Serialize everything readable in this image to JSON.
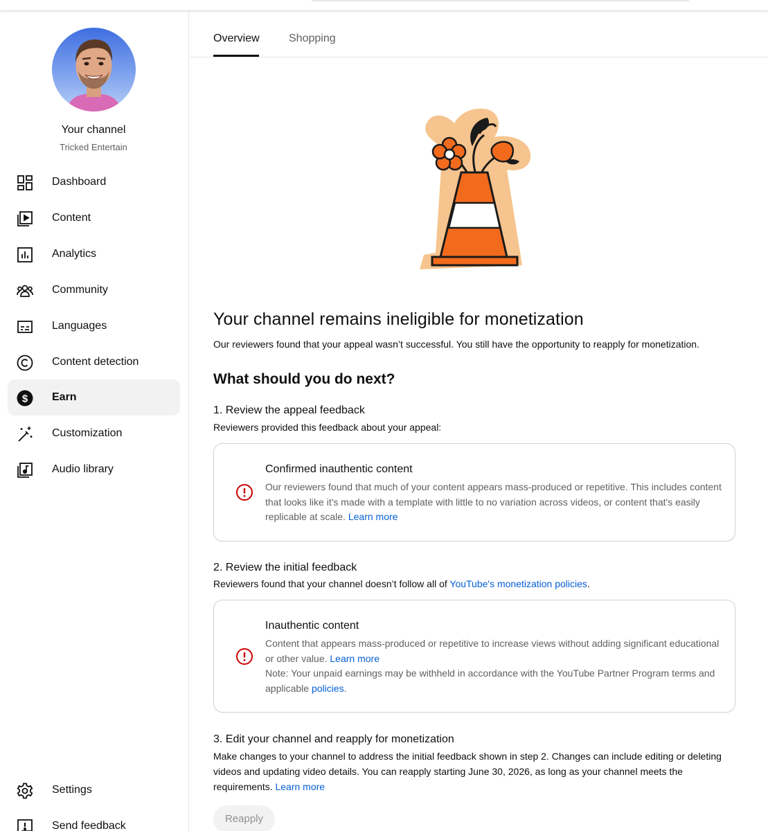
{
  "sidebar": {
    "channel_title": "Your channel",
    "channel_name": "Tricked Entertain",
    "items": [
      {
        "label": "Dashboard",
        "icon": "dashboard-icon"
      },
      {
        "label": "Content",
        "icon": "content-icon"
      },
      {
        "label": "Analytics",
        "icon": "analytics-icon"
      },
      {
        "label": "Community",
        "icon": "community-icon"
      },
      {
        "label": "Languages",
        "icon": "languages-icon"
      },
      {
        "label": "Content detection",
        "icon": "copyright-icon"
      },
      {
        "label": "Earn",
        "icon": "dollar-icon",
        "active": true
      },
      {
        "label": "Customization",
        "icon": "magic-wand-icon"
      },
      {
        "label": "Audio library",
        "icon": "audio-library-icon"
      }
    ],
    "bottom_items": [
      {
        "label": "Settings",
        "icon": "gear-icon"
      },
      {
        "label": "Send feedback",
        "icon": "feedback-icon"
      }
    ]
  },
  "tabs": [
    "Overview",
    "Shopping"
  ],
  "main": {
    "heading": "Your channel remains ineligible for monetization",
    "lead": "Our reviewers found that your appeal wasn’t successful. You still have the opportunity to reapply for monetization.",
    "next_heading": "What should you do next?",
    "step1": {
      "title": "1. Review the appeal feedback",
      "text": "Reviewers provided this feedback about your appeal:",
      "card_title": "Confirmed inauthentic content",
      "card_body": "Our reviewers found that much of your content appears mass-produced or repetitive. This includes content that looks like it's made with a template with little to no variation across videos, or content that's easily replicable at scale.",
      "card_link": "Learn more"
    },
    "step2": {
      "title": "2. Review the initial feedback",
      "text": "Reviewers found that your channel doesn’t follow all of",
      "text_link": "YouTube's monetization policies",
      "text_end": ".",
      "card_title": "Inauthentic content",
      "card_body": "Content that appears mass-produced or repetitive to increase views without adding significant educational or other value.",
      "card_link": "Learn more",
      "card_note": "Note: Your unpaid earnings may be withheld in accordance with the YouTube Partner Program terms and applicable",
      "card_note_link": "policies",
      "card_note_end": "."
    },
    "step3": {
      "title": "3. Edit your channel and reapply for monetization",
      "text": "Make changes to your channel to address the initial feedback shown in step 2. Changes can include editing or deleting videos and updating video details. You can reapply starting June 30, 2026, as long as your channel meets the requirements.",
      "link": "Learn more"
    },
    "reapply_label": "Reapply"
  },
  "colors": {
    "accent_link": "#065fd4",
    "warning_red": "#cc0000",
    "cone_orange": "#f26b1d",
    "cone_halo": "#f6c48e"
  }
}
